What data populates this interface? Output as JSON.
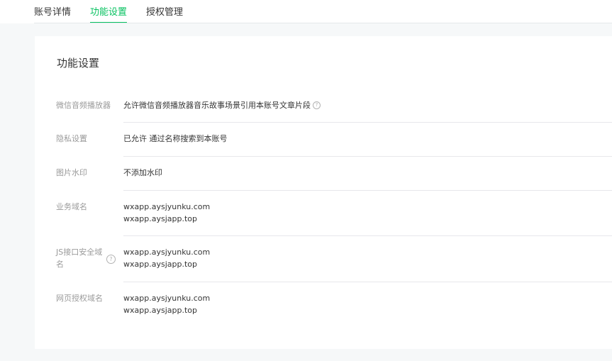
{
  "tabs": [
    {
      "label": "账号详情",
      "active": false
    },
    {
      "label": "功能设置",
      "active": true
    },
    {
      "label": "授权管理",
      "active": false
    }
  ],
  "section": {
    "title": "功能设置"
  },
  "settings": {
    "audio_player": {
      "label": "微信音频播放器",
      "value": "允许微信音频播放器音乐故事场景引用本账号文章片段",
      "help_icon": "question-circle-icon"
    },
    "privacy": {
      "label": "隐私设置",
      "value": "已允许 通过名称搜索到本账号"
    },
    "watermark": {
      "label": "图片水印",
      "value": "不添加水印"
    },
    "business_domain": {
      "label": "业务域名",
      "values": [
        "wxapp.aysjyunku.com",
        "wxapp.aysjapp.top"
      ]
    },
    "js_domain": {
      "label": "JS接口安全域名",
      "values": [
        "wxapp.aysjyunku.com",
        "wxapp.aysjapp.top"
      ],
      "help_icon": "question-circle-icon"
    },
    "web_auth_domain": {
      "label": "网页授权域名",
      "values": [
        "wxapp.aysjyunku.com",
        "wxapp.aysjapp.top"
      ]
    }
  },
  "colors": {
    "accent": "#07c160",
    "label": "#9a9a9a",
    "text": "#353535",
    "divider": "#e7e7eb",
    "page_bg": "#f6f8f9"
  }
}
